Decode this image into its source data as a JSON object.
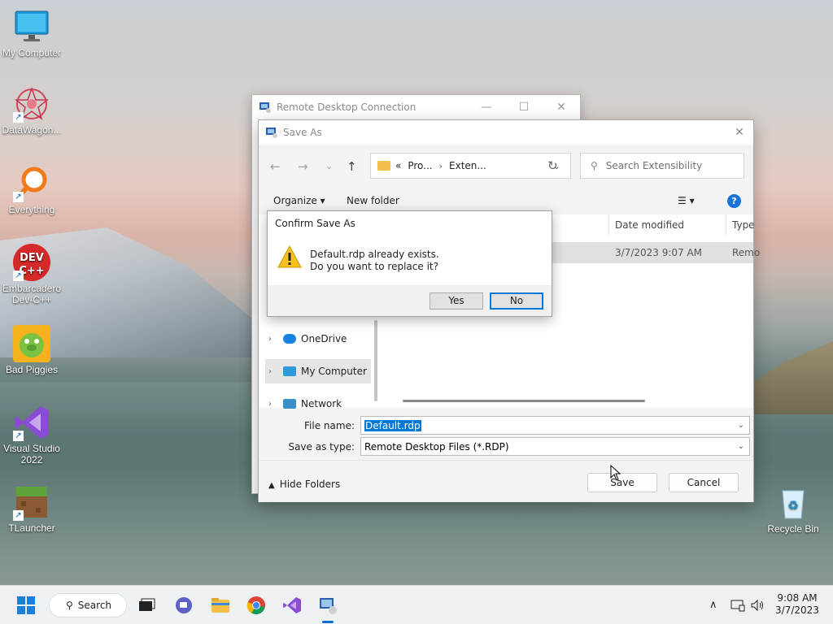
{
  "desktop": {
    "icons": [
      {
        "label": "My Computer"
      },
      {
        "label": "DataWagon..."
      },
      {
        "label": "Everything"
      },
      {
        "label": "Embarcadero Dev-C++"
      },
      {
        "label": "Bad Piggies"
      },
      {
        "label": "Visual Studio 2022"
      },
      {
        "label": "TLauncher"
      },
      {
        "label": "Recycle Bin"
      }
    ]
  },
  "rdc_window": {
    "title": "Remote Desktop Connection",
    "minimize": "—",
    "maximize": "☐",
    "close": "✕"
  },
  "save_as": {
    "title": "Save As",
    "close": "✕",
    "nav": {
      "back": "←",
      "forward": "→",
      "recent": "⌄",
      "up": "↑"
    },
    "address": {
      "overflow": "«",
      "crumbs": [
        "Pro...",
        "Exten..."
      ],
      "separator": "›",
      "dropdown": "⌄",
      "refresh": "↻"
    },
    "search": {
      "placeholder": "Search Extensibility"
    },
    "toolbar": {
      "organize": "Organize ▾",
      "new_folder": "New folder",
      "view": "☰ ▾",
      "help": "?"
    },
    "nav_pane": {
      "items": [
        {
          "label": "OneDrive",
          "selected": false
        },
        {
          "label": "My Computer",
          "selected": true
        },
        {
          "label": "Network",
          "selected": false
        }
      ]
    },
    "columns": [
      "Date modified",
      "Type"
    ],
    "file": {
      "date": "3/7/2023 9:07 AM",
      "type": "Remo"
    },
    "file_name": {
      "label": "File name:",
      "value": "Default.rdp"
    },
    "save_type": {
      "label": "Save as type:",
      "value": "Remote Desktop Files (*.RDP)"
    },
    "hide_folders": "Hide Folders",
    "save_button": "Save",
    "cancel_button": "Cancel"
  },
  "confirm": {
    "title": "Confirm Save As",
    "line1": "Default.rdp already exists.",
    "line2": "Do you want to replace it?",
    "yes": "Yes",
    "no": "No"
  },
  "taskbar": {
    "search_label": "Search",
    "time": "9:08 AM",
    "date": "3/7/2023",
    "tray_chevron": "∧"
  }
}
